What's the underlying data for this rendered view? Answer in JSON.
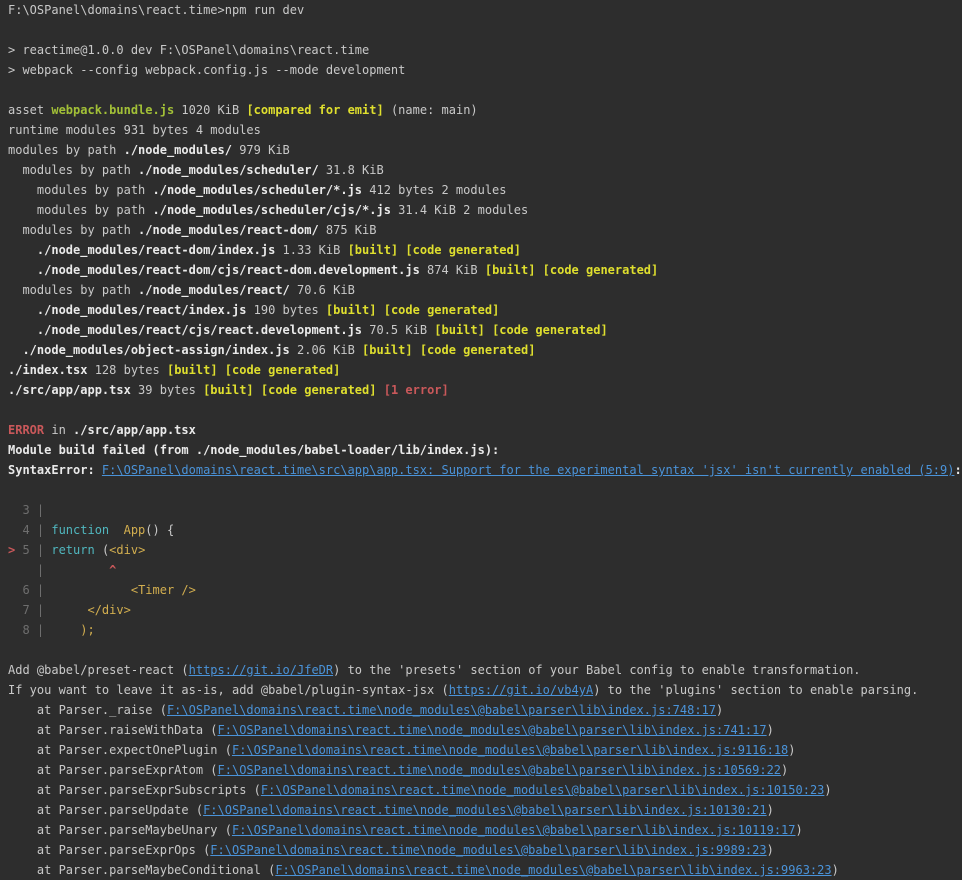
{
  "terminal": {
    "bg": "#2d2d2d",
    "colors": {
      "default": "#c9c9c9",
      "bright": "#eaeaea",
      "green": "#a2c037",
      "yellow": "#dfdf2e",
      "gold": "#d2ae4f",
      "red": "#c9585a",
      "blue": "#4a93d9",
      "cyan": "#50b7bf",
      "gray": "#6e6e6e"
    },
    "lines": [
      [
        {
          "t": "F:\\OSPanel\\domains\\react.time>npm run dev"
        }
      ],
      [],
      [
        {
          "t": "> reactime@1.0.0 dev F:\\OSPanel\\domains\\react.time"
        }
      ],
      [
        {
          "t": "> webpack --config webpack.config.js --mode development"
        }
      ],
      [],
      [
        {
          "t": "asset "
        },
        {
          "t": "webpack.bundle.js",
          "c": "green",
          "b": 1
        },
        {
          "t": " 1020 KiB "
        },
        {
          "t": "[compared for emit]",
          "c": "yellow",
          "b": 1
        },
        {
          "t": " (name: main)"
        }
      ],
      [
        {
          "t": "runtime modules 931 bytes 4 modules"
        }
      ],
      [
        {
          "t": "modules by path "
        },
        {
          "t": "./node_modules/",
          "c": "bright",
          "b": 1
        },
        {
          "t": " 979 KiB"
        }
      ],
      [
        {
          "t": "  modules by path "
        },
        {
          "t": "./node_modules/scheduler/",
          "c": "bright",
          "b": 1
        },
        {
          "t": " 31.8 KiB"
        }
      ],
      [
        {
          "t": "    modules by path "
        },
        {
          "t": "./node_modules/scheduler/*.js",
          "c": "bright",
          "b": 1
        },
        {
          "t": " 412 bytes 2 modules"
        }
      ],
      [
        {
          "t": "    modules by path "
        },
        {
          "t": "./node_modules/scheduler/cjs/*.js",
          "c": "bright",
          "b": 1
        },
        {
          "t": " 31.4 KiB 2 modules"
        }
      ],
      [
        {
          "t": "  modules by path "
        },
        {
          "t": "./node_modules/react-dom/",
          "c": "bright",
          "b": 1
        },
        {
          "t": " 875 KiB"
        }
      ],
      [
        {
          "t": "    "
        },
        {
          "t": "./node_modules/react-dom/index.js",
          "c": "bright",
          "b": 1
        },
        {
          "t": " 1.33 KiB "
        },
        {
          "t": "[built]",
          "c": "yellow",
          "b": 1
        },
        {
          "t": " "
        },
        {
          "t": "[code generated]",
          "c": "yellow",
          "b": 1
        }
      ],
      [
        {
          "t": "    "
        },
        {
          "t": "./node_modules/react-dom/cjs/react-dom.development.js",
          "c": "bright",
          "b": 1
        },
        {
          "t": " 874 KiB "
        },
        {
          "t": "[built]",
          "c": "yellow",
          "b": 1
        },
        {
          "t": " "
        },
        {
          "t": "[code generated]",
          "c": "yellow",
          "b": 1
        }
      ],
      [
        {
          "t": "  modules by path "
        },
        {
          "t": "./node_modules/react/",
          "c": "bright",
          "b": 1
        },
        {
          "t": " 70.6 KiB"
        }
      ],
      [
        {
          "t": "    "
        },
        {
          "t": "./node_modules/react/index.js",
          "c": "bright",
          "b": 1
        },
        {
          "t": " 190 bytes "
        },
        {
          "t": "[built]",
          "c": "yellow",
          "b": 1
        },
        {
          "t": " "
        },
        {
          "t": "[code generated]",
          "c": "yellow",
          "b": 1
        }
      ],
      [
        {
          "t": "    "
        },
        {
          "t": "./node_modules/react/cjs/react.development.js",
          "c": "bright",
          "b": 1
        },
        {
          "t": " 70.5 KiB "
        },
        {
          "t": "[built]",
          "c": "yellow",
          "b": 1
        },
        {
          "t": " "
        },
        {
          "t": "[code generated]",
          "c": "yellow",
          "b": 1
        }
      ],
      [
        {
          "t": "  "
        },
        {
          "t": "./node_modules/object-assign/index.js",
          "c": "bright",
          "b": 1
        },
        {
          "t": " 2.06 KiB "
        },
        {
          "t": "[built]",
          "c": "yellow",
          "b": 1
        },
        {
          "t": " "
        },
        {
          "t": "[code generated]",
          "c": "yellow",
          "b": 1
        }
      ],
      [
        {
          "t": "./index.tsx",
          "c": "bright",
          "b": 1
        },
        {
          "t": " 128 bytes "
        },
        {
          "t": "[built]",
          "c": "yellow",
          "b": 1
        },
        {
          "t": " "
        },
        {
          "t": "[code generated]",
          "c": "yellow",
          "b": 1
        }
      ],
      [
        {
          "t": "./src/app/app.tsx",
          "c": "bright",
          "b": 1
        },
        {
          "t": " 39 bytes "
        },
        {
          "t": "[built]",
          "c": "yellow",
          "b": 1
        },
        {
          "t": " "
        },
        {
          "t": "[code generated]",
          "c": "yellow",
          "b": 1
        },
        {
          "t": " "
        },
        {
          "t": "[1 error]",
          "c": "red",
          "b": 1
        }
      ],
      [],
      [
        {
          "t": "ERROR",
          "c": "red",
          "b": 1
        },
        {
          "t": " in "
        },
        {
          "t": "./src/app/app.tsx",
          "c": "bright",
          "b": 1
        }
      ],
      [
        {
          "t": "Module build failed (from ./node_modules/babel-loader/lib/index.js):",
          "c": "bright",
          "b": 1
        }
      ],
      [
        {
          "t": "SyntaxError: ",
          "c": "bright",
          "b": 1
        },
        {
          "t": "F:\\OSPanel\\domains\\react.time\\src\\app\\app.tsx: Support for the experimental syntax 'jsx' isn't currently enabled (5:9)",
          "c": "blue",
          "u": 1
        },
        {
          "t": ":",
          "c": "bright",
          "b": 1
        }
      ],
      [],
      [
        {
          "t": "  3 |",
          "c": "gray"
        }
      ],
      [
        {
          "t": "  4 | ",
          "c": "gray"
        },
        {
          "t": "function",
          "c": "cyan"
        },
        {
          "t": "  "
        },
        {
          "t": "App",
          "c": "gold"
        },
        {
          "t": "() {"
        }
      ],
      [
        {
          "t": ">",
          "c": "red",
          "b": 1
        },
        {
          "t": " 5 | ",
          "c": "gray"
        },
        {
          "t": "return",
          "c": "cyan"
        },
        {
          "t": " ("
        },
        {
          "t": "<div>",
          "c": "gold"
        }
      ],
      [
        {
          "t": "    |",
          "c": "gray"
        },
        {
          "t": "         "
        },
        {
          "t": "^",
          "c": "red",
          "b": 1
        }
      ],
      [
        {
          "t": "  6 | ",
          "c": "gray"
        },
        {
          "t": "           "
        },
        {
          "t": "<Timer />",
          "c": "gold"
        }
      ],
      [
        {
          "t": "  7 | ",
          "c": "gray"
        },
        {
          "t": "     "
        },
        {
          "t": "</div>",
          "c": "gold"
        }
      ],
      [
        {
          "t": "  8 | ",
          "c": "gray"
        },
        {
          "t": "    "
        },
        {
          "t": ");",
          "c": "gold"
        }
      ],
      [],
      [
        {
          "t": "Add @babel/preset-react ("
        },
        {
          "t": "https://git.io/JfeDR",
          "c": "blue",
          "u": 1
        },
        {
          "t": ") to the 'presets' section of your Babel config to enable transformation."
        }
      ],
      [
        {
          "t": "If you want to leave it as-is, add @babel/plugin-syntax-jsx ("
        },
        {
          "t": "https://git.io/vb4yA",
          "c": "blue",
          "u": 1
        },
        {
          "t": ") to the 'plugins' section to enable parsing."
        }
      ],
      [
        {
          "t": "    at Parser._raise ("
        },
        {
          "t": "F:\\OSPanel\\domains\\react.time\\node_modules\\@babel\\parser\\lib\\index.js:748:17",
          "c": "blue",
          "u": 1
        },
        {
          "t": ")"
        }
      ],
      [
        {
          "t": "    at Parser.raiseWithData ("
        },
        {
          "t": "F:\\OSPanel\\domains\\react.time\\node_modules\\@babel\\parser\\lib\\index.js:741:17",
          "c": "blue",
          "u": 1
        },
        {
          "t": ")"
        }
      ],
      [
        {
          "t": "    at Parser.expectOnePlugin ("
        },
        {
          "t": "F:\\OSPanel\\domains\\react.time\\node_modules\\@babel\\parser\\lib\\index.js:9116:18",
          "c": "blue",
          "u": 1
        },
        {
          "t": ")"
        }
      ],
      [
        {
          "t": "    at Parser.parseExprAtom ("
        },
        {
          "t": "F:\\OSPanel\\domains\\react.time\\node_modules\\@babel\\parser\\lib\\index.js:10569:22",
          "c": "blue",
          "u": 1
        },
        {
          "t": ")"
        }
      ],
      [
        {
          "t": "    at Parser.parseExprSubscripts ("
        },
        {
          "t": "F:\\OSPanel\\domains\\react.time\\node_modules\\@babel\\parser\\lib\\index.js:10150:23",
          "c": "blue",
          "u": 1
        },
        {
          "t": ")"
        }
      ],
      [
        {
          "t": "    at Parser.parseUpdate ("
        },
        {
          "t": "F:\\OSPanel\\domains\\react.time\\node_modules\\@babel\\parser\\lib\\index.js:10130:21",
          "c": "blue",
          "u": 1
        },
        {
          "t": ")"
        }
      ],
      [
        {
          "t": "    at Parser.parseMaybeUnary ("
        },
        {
          "t": "F:\\OSPanel\\domains\\react.time\\node_modules\\@babel\\parser\\lib\\index.js:10119:17",
          "c": "blue",
          "u": 1
        },
        {
          "t": ")"
        }
      ],
      [
        {
          "t": "    at Parser.parseExprOps ("
        },
        {
          "t": "F:\\OSPanel\\domains\\react.time\\node_modules\\@babel\\parser\\lib\\index.js:9989:23",
          "c": "blue",
          "u": 1
        },
        {
          "t": ")"
        }
      ],
      [
        {
          "t": "    at Parser.parseMaybeConditional ("
        },
        {
          "t": "F:\\OSPanel\\domains\\react.time\\node_modules\\@babel\\parser\\lib\\index.js:9963:23",
          "c": "blue",
          "u": 1
        },
        {
          "t": ")"
        }
      ]
    ]
  }
}
